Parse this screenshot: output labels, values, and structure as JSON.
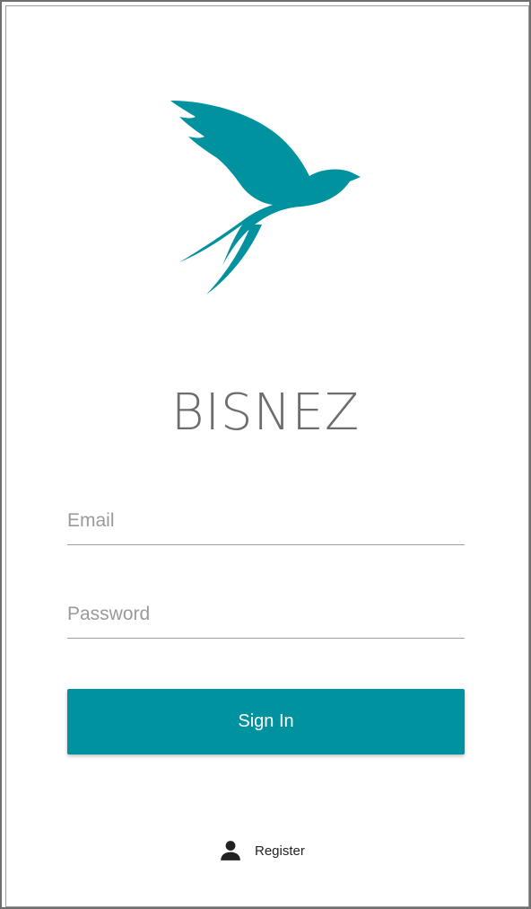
{
  "app": {
    "title": "BISNEZ",
    "brand_color": "#00929f",
    "logo_icon": "swallow-bird-icon"
  },
  "form": {
    "email": {
      "placeholder": "Email",
      "value": ""
    },
    "password": {
      "placeholder": "Password",
      "value": ""
    },
    "submit_label": "Sign In"
  },
  "footer": {
    "register_label": "Register",
    "register_icon": "person-icon"
  }
}
